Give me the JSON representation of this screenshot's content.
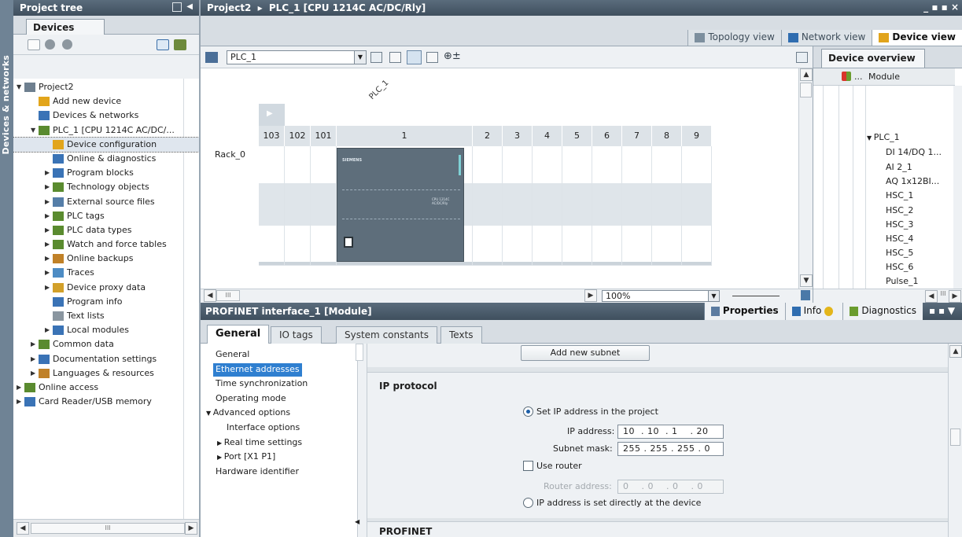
{
  "side_strip": {
    "label": "Devices & networks"
  },
  "project_tree": {
    "title": "Project tree",
    "tab": "Devices",
    "items": [
      {
        "label": "Project2",
        "level": 0,
        "expanded": true
      },
      {
        "label": "Add new device",
        "level": 1
      },
      {
        "label": "Devices & networks",
        "level": 1
      },
      {
        "label": "PLC_1 [CPU 1214C AC/DC/...",
        "level": 1,
        "expanded": true
      },
      {
        "label": "Device configuration",
        "level": 2,
        "selected": true
      },
      {
        "label": "Online & diagnostics",
        "level": 2
      },
      {
        "label": "Program blocks",
        "level": 2,
        "collapsed": true
      },
      {
        "label": "Technology objects",
        "level": 2,
        "collapsed": true
      },
      {
        "label": "External source files",
        "level": 2,
        "collapsed": true
      },
      {
        "label": "PLC tags",
        "level": 2,
        "collapsed": true
      },
      {
        "label": "PLC data types",
        "level": 2,
        "collapsed": true
      },
      {
        "label": "Watch and force tables",
        "level": 2,
        "collapsed": true
      },
      {
        "label": "Online backups",
        "level": 2,
        "collapsed": true
      },
      {
        "label": "Traces",
        "level": 2,
        "collapsed": true
      },
      {
        "label": "Device proxy data",
        "level": 2,
        "collapsed": true
      },
      {
        "label": "Program info",
        "level": 2
      },
      {
        "label": "Text lists",
        "level": 2
      },
      {
        "label": "Local modules",
        "level": 2,
        "collapsed": true
      },
      {
        "label": "Common data",
        "level": 1,
        "collapsed": true
      },
      {
        "label": "Documentation settings",
        "level": 1,
        "collapsed": true
      },
      {
        "label": "Languages & resources",
        "level": 1,
        "collapsed": true
      },
      {
        "label": "Online access",
        "level": 0,
        "collapsed": true
      },
      {
        "label": "Card Reader/USB memory",
        "level": 0,
        "collapsed": true
      }
    ],
    "scroll_thumb": "III"
  },
  "window": {
    "breadcrumb_project": "Project2",
    "breadcrumb_sep": "▸",
    "breadcrumb_device": "PLC_1 [CPU 1214C AC/DC/Rly]",
    "controls": "_ ▪ ▪ ×"
  },
  "views": {
    "topology": "Topology view",
    "network": "Network view",
    "device": "Device view"
  },
  "graphic_toolbar": {
    "device_select": "PLC_1"
  },
  "rack": {
    "plc_label": "PLC_1",
    "rack_name": "Rack_0",
    "slots": [
      "103",
      "102",
      "101",
      "1",
      "2",
      "3",
      "4",
      "5",
      "6",
      "7",
      "8",
      "9"
    ],
    "cpu_brand": "SIEMENS",
    "cpu_model": "CPU 1214C AC/DC/Rly"
  },
  "canvas": {
    "zoom": "100%",
    "scroll_thumb": "III"
  },
  "device_overview": {
    "tab": "Device overview",
    "col_dots": "...",
    "col_module": "Module",
    "rows": [
      "PLC_1",
      "DI 14/DQ 1...",
      "AI 2_1",
      "AQ 1x12BI...",
      "HSC_1",
      "HSC_2",
      "HSC_3",
      "HSC_4",
      "HSC_5",
      "HSC_6",
      "Pulse_1"
    ],
    "scroll_thumb": "III"
  },
  "properties": {
    "title": "PROFINET interface_1 [Module]",
    "top_tabs": {
      "properties": "Properties",
      "info": "Info",
      "diagnostics": "Diagnostics"
    },
    "sub_tabs": [
      "General",
      "IO tags",
      "System constants",
      "Texts"
    ],
    "nav": [
      {
        "label": "General",
        "level": 0
      },
      {
        "label": "Ethernet addresses",
        "level": 0,
        "selected": true
      },
      {
        "label": "Time synchronization",
        "level": 0
      },
      {
        "label": "Operating mode",
        "level": 0
      },
      {
        "label": "Advanced options",
        "level": 0,
        "expanded": true
      },
      {
        "label": "Interface options",
        "level": 1
      },
      {
        "label": "Real time settings",
        "level": 1,
        "collapsed": true
      },
      {
        "label": "Port [X1 P1]",
        "level": 1,
        "collapsed": true
      },
      {
        "label": "Hardware identifier",
        "level": 0
      }
    ],
    "add_subnet": "Add new subnet",
    "ip_protocol": {
      "title": "IP protocol",
      "set_in_project": "Set IP address in the project",
      "ip_label": "IP address:",
      "ip_value": "10  . 10  . 1    . 20",
      "mask_label": "Subnet mask:",
      "mask_value": "255 . 255 . 255 . 0",
      "use_router": "Use router",
      "router_label": "Router address:",
      "router_value": "0    . 0    . 0    . 0",
      "set_directly": "IP address is set directly at the device"
    },
    "profinet_title": "PROFINET"
  }
}
